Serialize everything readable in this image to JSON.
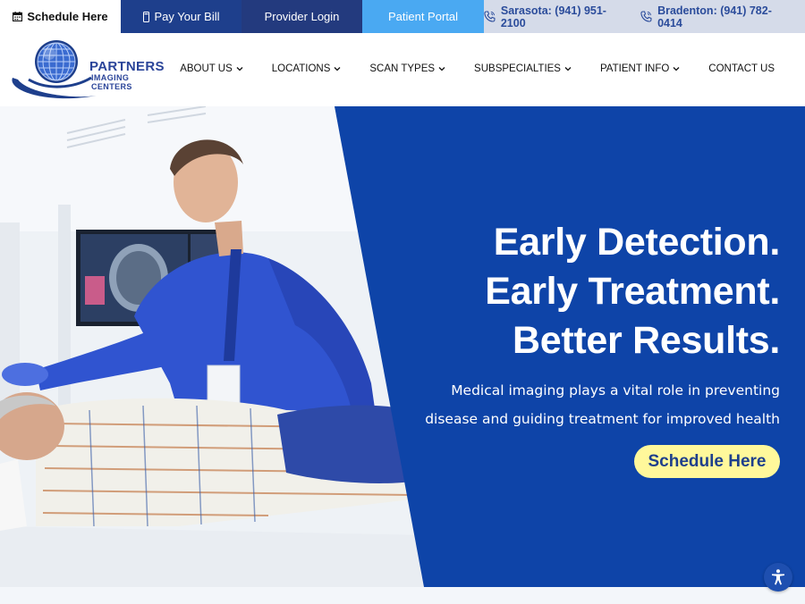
{
  "topbar": {
    "schedule_label": "Schedule Here",
    "pay_label": "Pay Your Bill",
    "provider_label": "Provider Login",
    "portal_label": "Patient Portal",
    "phones": [
      {
        "label": "Sarasota: (941) 951-2100"
      },
      {
        "label": "Bradenton: (941) 782-0414"
      }
    ]
  },
  "logo": {
    "line1": "PARTNERS",
    "line2": "IMAGING CENTERS"
  },
  "nav": {
    "items": [
      {
        "label": "ABOUT US"
      },
      {
        "label": "LOCATIONS"
      },
      {
        "label": "SCAN TYPES"
      },
      {
        "label": "SUBSPECIALTIES"
      },
      {
        "label": "PATIENT INFO"
      },
      {
        "label": "CONTACT US"
      }
    ]
  },
  "hero": {
    "lines": [
      "Early Detection.",
      "Early Treatment.",
      "Better Results."
    ],
    "subtitle": "Medical imaging plays a vital role in preventing disease and guiding treatment for improved health",
    "button_label": "Schedule Here"
  },
  "colors": {
    "brand_blue": "#1e3f8c",
    "hero_blue": "#0e44a8",
    "portal_blue": "#4aa9f2",
    "button_yellow": "#fff89b"
  },
  "icons": [
    "calendar-icon",
    "card-icon",
    "phone-icon",
    "chevron-down-icon",
    "accessibility-icon"
  ]
}
